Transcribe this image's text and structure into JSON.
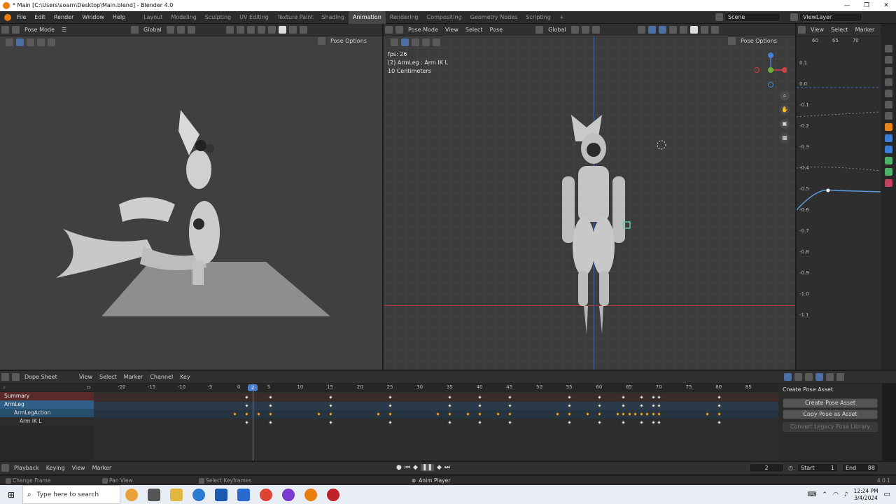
{
  "window": {
    "title": "* Main [C:\\Users\\soarn\\Desktop\\Main.blend] - Blender 4.0",
    "controls": [
      "—",
      "❐",
      "✕"
    ]
  },
  "menu": [
    "File",
    "Edit",
    "Render",
    "Window",
    "Help"
  ],
  "workspaces": [
    "Layout",
    "Modeling",
    "Sculpting",
    "UV Editing",
    "Texture Paint",
    "Shading",
    "Animation",
    "Rendering",
    "Compositing",
    "Geometry Nodes",
    "Scripting"
  ],
  "active_workspace": "Animation",
  "scene": "Scene",
  "view_layer": "ViewLayer",
  "vp1": {
    "mode": "Pose Mode",
    "orientation": "Global",
    "pose_options": "Pose Options"
  },
  "vp2": {
    "mode": "Pose Mode",
    "menus": [
      "View",
      "Select",
      "Pose"
    ],
    "orientation": "Global",
    "pose_options": "Pose Options",
    "overlay": [
      "fps: 26",
      "(2) ArmLeg : Arm IK L",
      "10 Centimeters"
    ]
  },
  "graph": {
    "menus": [
      "View",
      "Select",
      "Marker"
    ],
    "xticks": [
      "60",
      "65",
      "70"
    ],
    "yticks": [
      "0.1",
      "0.0",
      "-0.1",
      "-0.2",
      "-0.3",
      "-0.4",
      "-0.5",
      "-0.6",
      "-0.7",
      "-0.8",
      "-0.9",
      "-1.0",
      "-1.1"
    ]
  },
  "dope": {
    "editor": "Dope Sheet",
    "menus": [
      "View",
      "Select",
      "Marker",
      "Channel",
      "Key"
    ],
    "ruler": [
      "-20",
      "-15",
      "-10",
      "-5",
      "0",
      "5",
      "10",
      "15",
      "20",
      "25",
      "30",
      "35",
      "40",
      "45",
      "50",
      "55",
      "60",
      "65",
      "70",
      "75",
      "80",
      "85"
    ],
    "current_frame": "2",
    "channels": [
      "Summary",
      "ArmLeg",
      "ArmLegAction",
      "Arm IK L"
    ]
  },
  "pose_panel": {
    "heading": "Create Pose Asset",
    "buttons": [
      "Create Pose Asset",
      "Copy Pose as Asset",
      "Convert Legacy Pose Library"
    ]
  },
  "timeline": {
    "menus": [
      "Playback",
      "Keying",
      "View",
      "Marker"
    ],
    "frame": "2",
    "start_label": "Start",
    "start": "1",
    "end_label": "End",
    "end": "88"
  },
  "status": {
    "items": [
      "Change Frame",
      "Pan View",
      "Select Keyframes",
      "Anim Player"
    ],
    "version": "4.0.1"
  },
  "taskbar": {
    "search_placeholder": "Type here to search",
    "time": "12:24 PM",
    "date": "3/4/2024"
  }
}
